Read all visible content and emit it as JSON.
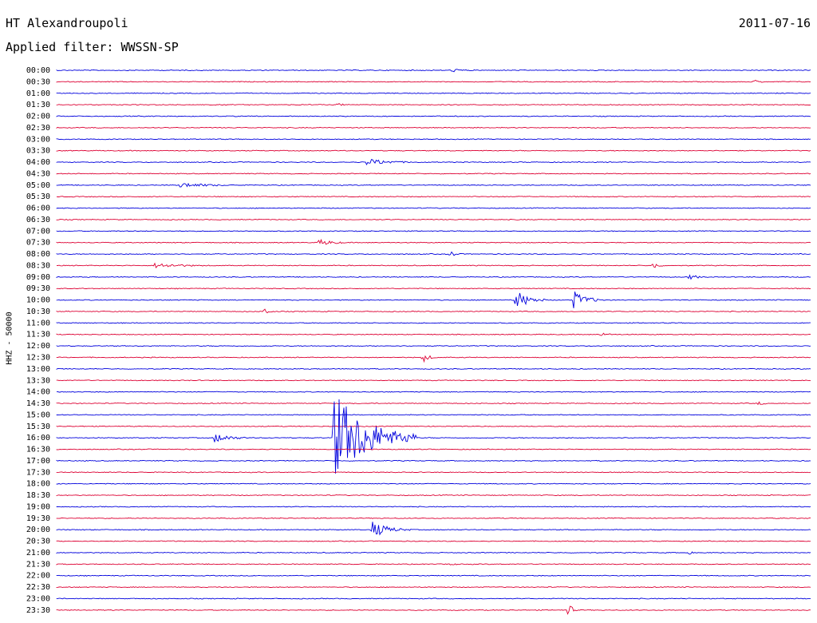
{
  "header": {
    "station": "HT Alexandroupoli",
    "date": "2011-07-16",
    "filter": "Applied filter: WWSSN-SP"
  },
  "chart_data": {
    "type": "line",
    "subtype": "helicorder",
    "channel_label": "HHZ - 50000",
    "rows": [
      "00:00",
      "00:30",
      "01:00",
      "01:30",
      "02:00",
      "02:30",
      "03:00",
      "03:30",
      "04:00",
      "04:30",
      "05:00",
      "05:30",
      "06:00",
      "06:30",
      "07:00",
      "07:30",
      "08:00",
      "08:30",
      "09:00",
      "09:30",
      "10:00",
      "10:30",
      "11:00",
      "11:30",
      "12:00",
      "12:30",
      "13:00",
      "13:30",
      "14:00",
      "14:30",
      "15:00",
      "15:30",
      "16:00",
      "16:30",
      "17:00",
      "17:30",
      "18:00",
      "18:30",
      "19:00",
      "19:30",
      "20:00",
      "20:30",
      "21:00",
      "21:30",
      "22:00",
      "22:30",
      "23:00",
      "23:30"
    ],
    "series_colors": [
      "#0000dd",
      "#dd0033"
    ],
    "events": [
      {
        "row": "00:00",
        "minute": 15.8,
        "amplitude": 2,
        "duration_min": 1.2
      },
      {
        "row": "00:30",
        "minute": 27.8,
        "amplitude": 2,
        "duration_min": 0.8
      },
      {
        "row": "01:30",
        "minute": 11.2,
        "amplitude": 2,
        "duration_min": 0.6
      },
      {
        "row": "04:00",
        "minute": 12.4,
        "amplitude": 4,
        "duration_min": 2.5
      },
      {
        "row": "05:00",
        "minute": 5.0,
        "amplitude": 3,
        "duration_min": 3.0
      },
      {
        "row": "07:30",
        "minute": 10.5,
        "amplitude": 4,
        "duration_min": 1.5
      },
      {
        "row": "08:00",
        "minute": 15.7,
        "amplitude": 4,
        "duration_min": 0.5
      },
      {
        "row": "08:30",
        "minute": 4.0,
        "amplitude": 3,
        "duration_min": 3.0
      },
      {
        "row": "08:30",
        "minute": 23.8,
        "amplitude": 4,
        "duration_min": 0.5
      },
      {
        "row": "09:00",
        "minute": 25.2,
        "amplitude": 3,
        "duration_min": 1.0
      },
      {
        "row": "10:00",
        "minute": 18.3,
        "amplitude": 12,
        "duration_min": 1.2
      },
      {
        "row": "10:00",
        "minute": 20.6,
        "amplitude": 11,
        "duration_min": 1.2
      },
      {
        "row": "10:30",
        "minute": 8.3,
        "amplitude": 5,
        "duration_min": 0.4
      },
      {
        "row": "11:30",
        "minute": 21.7,
        "amplitude": 2,
        "duration_min": 1.0
      },
      {
        "row": "12:30",
        "minute": 14.6,
        "amplitude": 6,
        "duration_min": 0.6
      },
      {
        "row": "14:30",
        "minute": 28.0,
        "amplitude": 2,
        "duration_min": 0.6
      },
      {
        "row": "16:00",
        "minute": 6.3,
        "amplitude": 6,
        "duration_min": 1.6
      },
      {
        "row": "16:00",
        "minute": 11.1,
        "amplitude": 55,
        "duration_min": 3.2
      },
      {
        "row": "20:00",
        "minute": 12.6,
        "amplitude": 10,
        "duration_min": 1.5
      },
      {
        "row": "21:00",
        "minute": 25.2,
        "amplitude": 2,
        "duration_min": 0.3
      },
      {
        "row": "21:30",
        "minute": 15.7,
        "amplitude": 2,
        "duration_min": 0.5
      },
      {
        "row": "23:30",
        "minute": 20.4,
        "amplitude": 9,
        "duration_min": 0.3
      }
    ]
  }
}
